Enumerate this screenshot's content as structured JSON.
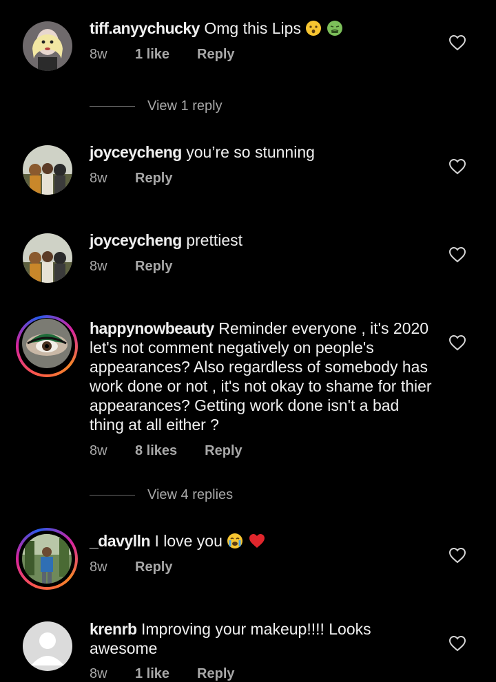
{
  "comments": [
    {
      "username": "tiff.anyychucky",
      "text": "Omg this Lips",
      "emojis": [
        "hushed-face-emoji",
        "nauseated-face-emoji"
      ],
      "age": "8w",
      "likes": "1 like",
      "reply_label": "Reply",
      "view_replies": "View 1 reply",
      "has_story_ring": false
    },
    {
      "username": "joyceycheng",
      "text": "you’re so stunning",
      "age": "8w",
      "reply_label": "Reply",
      "has_story_ring": false
    },
    {
      "username": "joyceycheng",
      "text": "prettiest",
      "age": "8w",
      "reply_label": "Reply",
      "has_story_ring": false
    },
    {
      "username": "happynowbeauty",
      "text": "Reminder everyone , it's 2020 let's not comment negatively on people's appearances? Also regardless of somebody has work done or not , it's not okay to shame for thier appearances? Getting work done isn't a bad thing at all either ?",
      "age": "8w",
      "likes": "8 likes",
      "reply_label": "Reply",
      "view_replies": "View 4 replies",
      "has_story_ring": true
    },
    {
      "username": "_davylln",
      "text": "I love you",
      "emojis": [
        "crying-face-emoji",
        "red-heart-emoji"
      ],
      "age": "8w",
      "reply_label": "Reply",
      "has_story_ring": true
    },
    {
      "username": "krenrb",
      "text": "Improving your makeup!!!! Looks awesome",
      "age": "8w",
      "likes": "1 like",
      "reply_label": "Reply",
      "has_story_ring": false
    }
  ],
  "colors": {
    "background": "#000000",
    "text": "#f0f0f0",
    "muted": "#a8a8a8"
  }
}
